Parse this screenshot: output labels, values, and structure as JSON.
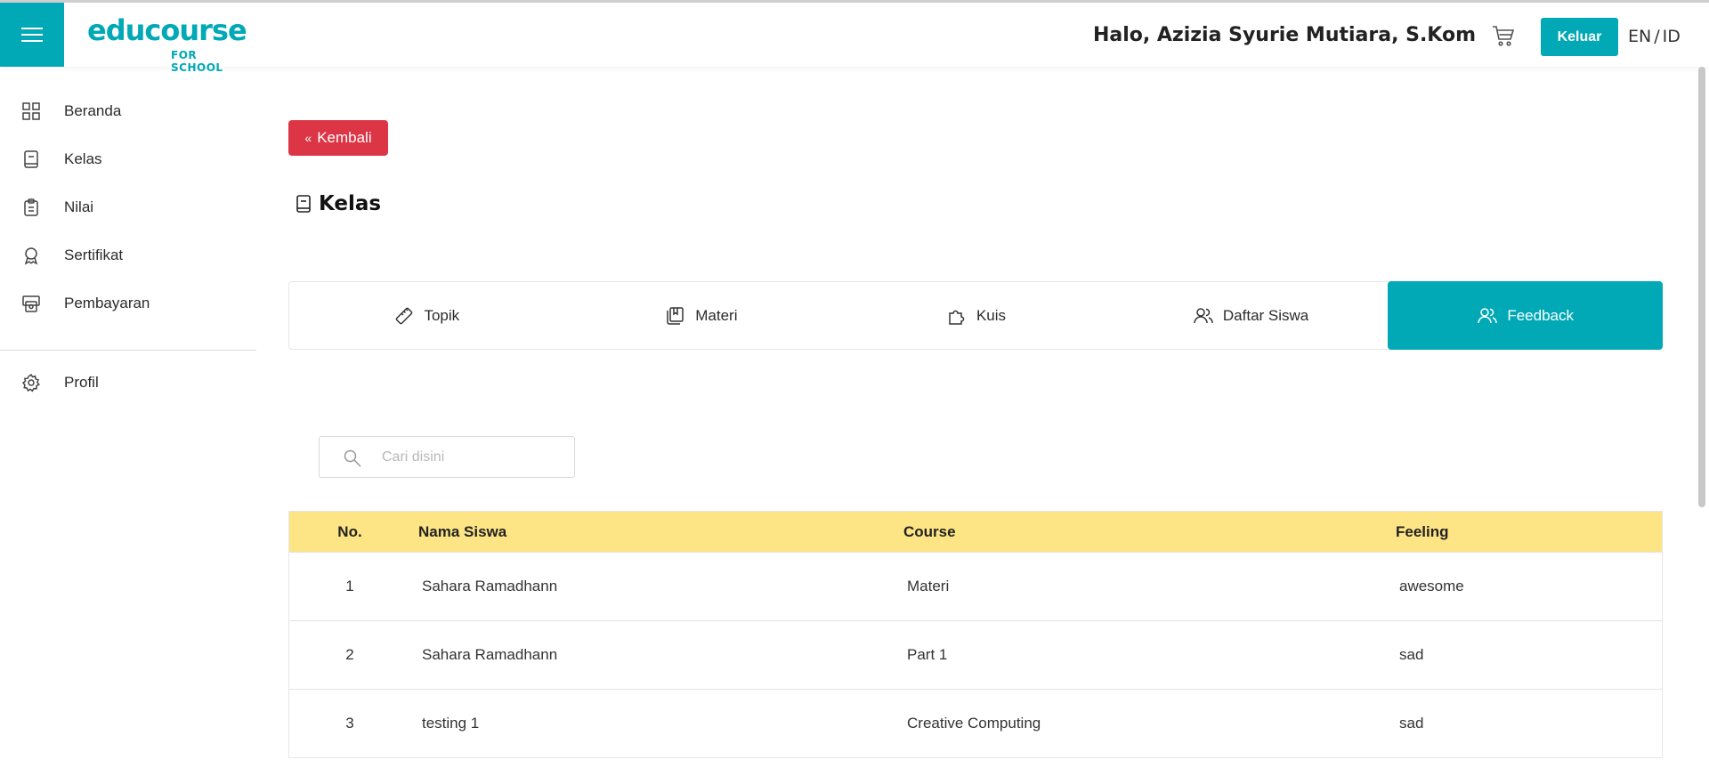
{
  "header": {
    "logo_main": "educourse",
    "logo_sub": "FOR SCHOOL",
    "greeting": "Halo, Azizia Syurie Mutiara, S.Kom",
    "logout_label": "Keluar",
    "lang_en": "EN",
    "lang_sep": "/",
    "lang_id": "ID"
  },
  "sidebar": {
    "items": [
      {
        "label": "Beranda",
        "icon": "grid-icon"
      },
      {
        "label": "Kelas",
        "icon": "book-icon"
      },
      {
        "label": "Nilai",
        "icon": "clipboard-icon"
      },
      {
        "label": "Sertifikat",
        "icon": "award-icon"
      },
      {
        "label": "Pembayaran",
        "icon": "payment-icon"
      },
      {
        "label": "Profil",
        "icon": "gear-icon"
      }
    ]
  },
  "main": {
    "back_label": "Kembali",
    "title": "Kelas",
    "tabs": [
      {
        "label": "Topik",
        "icon": "ruler-icon"
      },
      {
        "label": "Materi",
        "icon": "book-stack-icon"
      },
      {
        "label": "Kuis",
        "icon": "puzzle-icon"
      },
      {
        "label": "Daftar Siswa",
        "icon": "users-icon"
      },
      {
        "label": "Feedback",
        "icon": "users-icon",
        "active": true
      }
    ],
    "search_placeholder": "Cari disini",
    "table": {
      "headers": [
        "No.",
        "Nama Siswa",
        "Course",
        "Feeling"
      ],
      "rows": [
        [
          "1",
          "Sahara Ramadhann",
          "Materi",
          "awesome"
        ],
        [
          "2",
          "Sahara Ramadhann",
          "Part 1",
          "sad"
        ],
        [
          "3",
          "testing 1",
          "Creative Computing",
          "sad"
        ]
      ]
    }
  },
  "colors": {
    "accent": "#00a9b5",
    "danger": "#dc3545",
    "table_header": "#fde485"
  }
}
